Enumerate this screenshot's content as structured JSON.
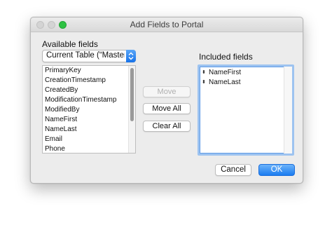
{
  "window": {
    "title": "Add Fields to Portal"
  },
  "available": {
    "label": "Available fields",
    "table_select": "Current Table (“Master",
    "fields": [
      "PrimaryKey",
      "CreationTimestamp",
      "CreatedBy",
      "ModificationTimestamp",
      "ModifiedBy",
      "NameFirst",
      "NameLast",
      "Email",
      "Phone"
    ]
  },
  "actions": {
    "move": "Move",
    "move_all": "Move All",
    "clear_all": "Clear All"
  },
  "included": {
    "label": "Included fields",
    "fields": [
      "NameFirst",
      "NameLast"
    ]
  },
  "footer": {
    "cancel": "Cancel",
    "ok": "OK"
  },
  "colors": {
    "accent": "#1a7cf0",
    "zoom_button": "#2ec243"
  },
  "icons": {
    "popup": "up-down-chevron-icon",
    "drag": "drag-handle-icon"
  }
}
